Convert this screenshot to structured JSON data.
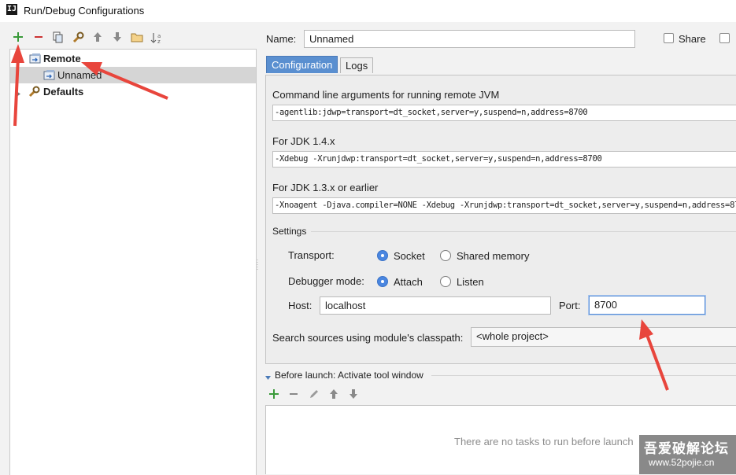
{
  "window": {
    "title": "Run/Debug Configurations",
    "app_icon_text": "IJ"
  },
  "toolbar": {
    "items": [
      "add-icon",
      "remove-icon",
      "copy-icon",
      "wrench-icon",
      "move-up-icon",
      "move-down-icon",
      "folder-icon",
      "sort-icon"
    ]
  },
  "tree": {
    "items": [
      {
        "label": "Remote",
        "level": 0,
        "expanded": true
      },
      {
        "label": "Unnamed",
        "level": 1,
        "selected": true
      },
      {
        "label": "Defaults",
        "level": 0,
        "expanded": false
      }
    ]
  },
  "header": {
    "name_label": "Name:",
    "name_value": "Unnamed",
    "share_label": "Share",
    "share_checked": false
  },
  "tabs": [
    "Configuration",
    "Logs"
  ],
  "config": {
    "cmd_label": "Command line arguments for running remote JVM",
    "cmd_value": "-agentlib:jdwp=transport=dt_socket,server=y,suspend=n,address=8700",
    "jdk14_label": "For JDK 1.4.x",
    "jdk14_value": "-Xdebug -Xrunjdwp:transport=dt_socket,server=y,suspend=n,address=8700",
    "jdk13_label": "For JDK 1.3.x or earlier",
    "jdk13_value": "-Xnoagent -Djava.compiler=NONE -Xdebug -Xrunjdwp:transport=dt_socket,server=y,suspend=n,address=87",
    "settings_label": "Settings",
    "transport_label": "Transport:",
    "transport_options": [
      "Socket",
      "Shared memory"
    ],
    "transport_selected": "Socket",
    "debugger_mode_label": "Debugger mode:",
    "debugger_mode_options": [
      "Attach",
      "Listen"
    ],
    "debugger_mode_selected": "Attach",
    "host_label": "Host:",
    "host_value": "localhost",
    "port_label": "Port:",
    "port_value": "8700",
    "classpath_label": "Search sources using module's classpath:",
    "classpath_value": "<whole project>"
  },
  "before_launch": {
    "title": "Before launch: Activate tool window",
    "toolbar": [
      "add-icon",
      "remove-icon",
      "edit-icon",
      "move-up-icon",
      "move-down-icon"
    ],
    "empty_text": "There are no tasks to run before launch"
  },
  "watermark": {
    "line1": "吾爱破解论坛",
    "line2": "www.52pojie.cn"
  },
  "colors": {
    "accent": "#4a86e0",
    "annotation": "#e8453c",
    "add_green": "#3a9a3a",
    "remove_red": "#cc3333"
  }
}
